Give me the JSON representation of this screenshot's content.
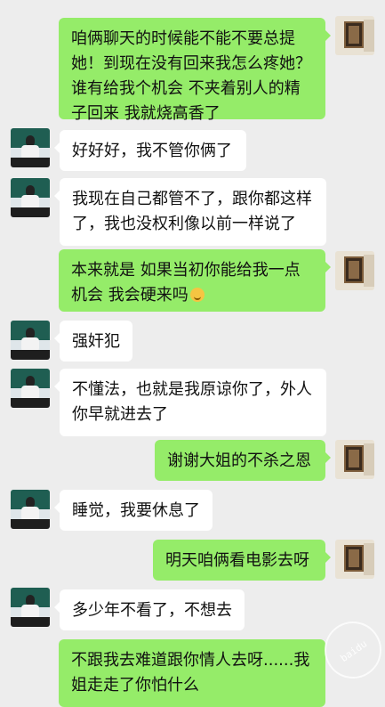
{
  "messages": [
    {
      "side": "right",
      "text": "咱俩聊天的时候能不能不要总提她！到现在没有回来我怎么疼她？谁有给我个机会 不夹着别人的精子回来 我就烧高香了"
    },
    {
      "side": "left",
      "text": "好好好，我不管你俩了"
    },
    {
      "side": "left",
      "text": "我现在自己都管不了，跟你都这样了，我也没权利像以前一样说了"
    },
    {
      "side": "right",
      "text": "本来就是 如果当初你能给我一点机会 我会硬来吗"
    },
    {
      "side": "left",
      "text": "强奸犯"
    },
    {
      "side": "left",
      "text": "不懂法，也就是我原谅你了，外人你早就进去了"
    },
    {
      "side": "right",
      "text": "谢谢大姐的不杀之恩"
    },
    {
      "side": "left",
      "text": "睡觉，我要休息了"
    },
    {
      "side": "right",
      "text": "明天咱俩看电影去呀"
    },
    {
      "side": "left",
      "text": "多少年不看了，不想去"
    },
    {
      "side": "right",
      "text": "不跟我去难道跟你情人去呀......我姐走走了你怕什么"
    }
  ],
  "watermark": "baidu"
}
